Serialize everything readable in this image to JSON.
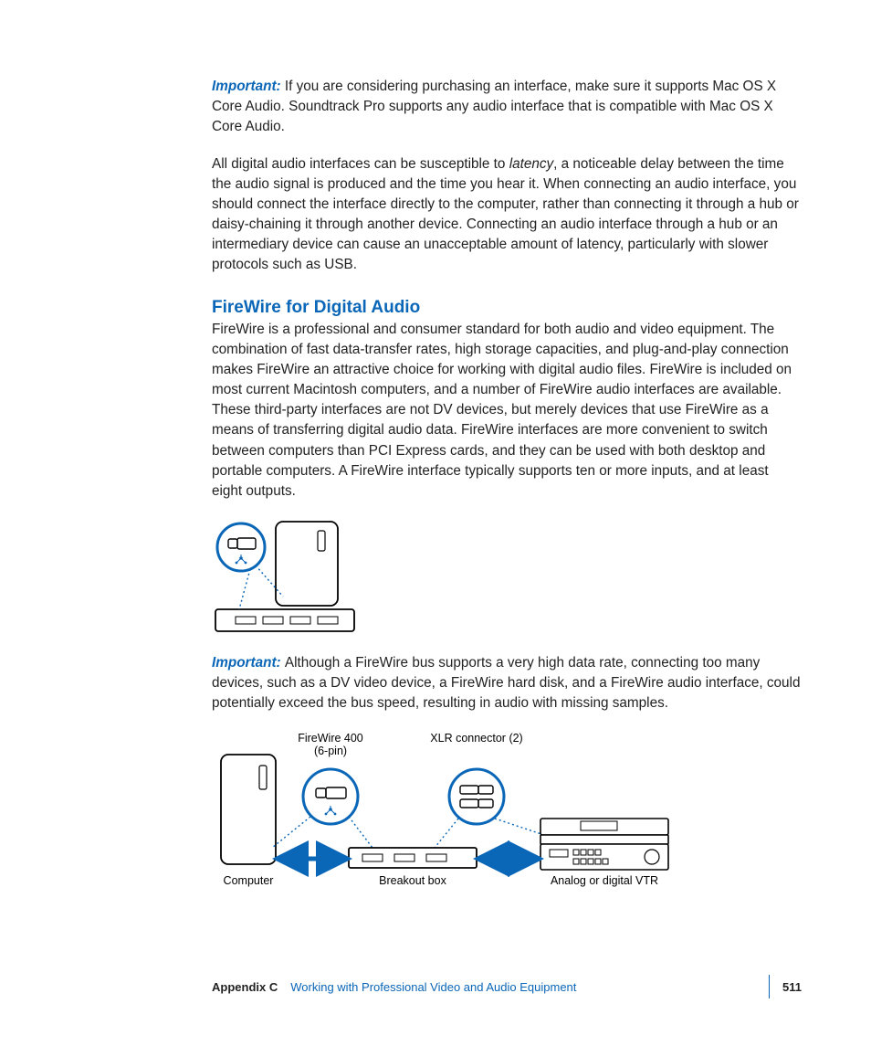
{
  "para1": {
    "important": "Important:  ",
    "text": "If you are considering purchasing an interface, make sure it supports Mac OS X Core Audio. Soundtrack Pro supports any audio interface that is compatible with Mac OS X Core Audio."
  },
  "para2": {
    "pre": "All digital audio interfaces can be susceptible to ",
    "ital": "latency",
    "post": ", a noticeable delay between the time the audio signal is produced and the time you hear it. When connecting an audio interface, you should connect the interface directly to the computer, rather than connecting it through a hub or daisy-chaining it through another device. Connecting an audio interface through a hub or an intermediary device can cause an unacceptable amount of latency, particularly with slower protocols such as USB."
  },
  "heading": "FireWire for Digital Audio",
  "para3": "FireWire is a professional and consumer standard for both audio and video equipment. The combination of fast data-transfer rates, high storage capacities, and plug-and-play connection makes FireWire an attractive choice for working with digital audio files. FireWire is included on most current Macintosh computers, and a number of FireWire audio interfaces are available. These third-party interfaces are not DV devices, but merely devices that use FireWire as a means of transferring digital audio data. FireWire interfaces are more convenient to switch between computers than PCI Express cards, and they can be used with both desktop and portable computers. A FireWire interface typically supports ten or more inputs, and at least eight outputs.",
  "para4": {
    "important": "Important:  ",
    "text": "Although a FireWire bus supports a very high data rate, connecting too many devices, such as a DV video device, a FireWire hard disk, and a FireWire audio interface, could potentially exceed the bus speed, resulting in audio with missing samples."
  },
  "fig2": {
    "fw400": "FireWire 400",
    "fw400b": "(6-pin)",
    "xlr": "XLR connector (2)",
    "computer": "Computer",
    "breakout": "Breakout box",
    "vtr": "Analog or digital VTR"
  },
  "footer": {
    "appendix": "Appendix C",
    "title": "Working with Professional Video and Audio Equipment",
    "pageno": "511"
  }
}
